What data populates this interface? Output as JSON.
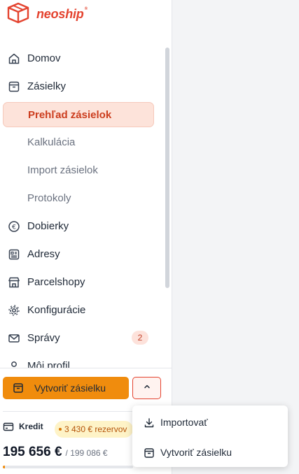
{
  "app": {
    "brand": "neoship",
    "registered_mark": "®"
  },
  "nav": {
    "items": [
      {
        "label": "Domov",
        "icon": "home-icon"
      },
      {
        "label": "Zásielky",
        "icon": "box-icon"
      },
      {
        "label": "Prehľad zásielok",
        "active": true
      },
      {
        "label": "Kalkulácia"
      },
      {
        "label": "Import zásielok"
      },
      {
        "label": "Protokoly"
      },
      {
        "label": "Dobierky",
        "icon": "euro-circle-icon"
      },
      {
        "label": "Adresy",
        "icon": "address-book-icon"
      },
      {
        "label": "Parcelshopy",
        "icon": "store-icon"
      },
      {
        "label": "Konfigurácie",
        "icon": "gear-icon"
      },
      {
        "label": "Správy",
        "icon": "mail-icon",
        "badge": "2"
      },
      {
        "label": "Môj profil",
        "icon": "user-icon"
      }
    ]
  },
  "actions": {
    "create_label": "Vytvoriť zásielku"
  },
  "credit": {
    "label": "Kredit",
    "reserved": "3 430 € rezervov",
    "amount": "195 656 €",
    "total": "/ 199 086 €",
    "progress_fraction": 0.017
  },
  "dropdown": {
    "items": [
      {
        "label": "Importovať",
        "icon": "download-icon"
      },
      {
        "label": "Vytvoriť zásielku",
        "icon": "box-icon"
      }
    ]
  },
  "colors": {
    "accent": "#e4432f",
    "button": "#f08c0d",
    "active_bg": "#fde3da"
  }
}
